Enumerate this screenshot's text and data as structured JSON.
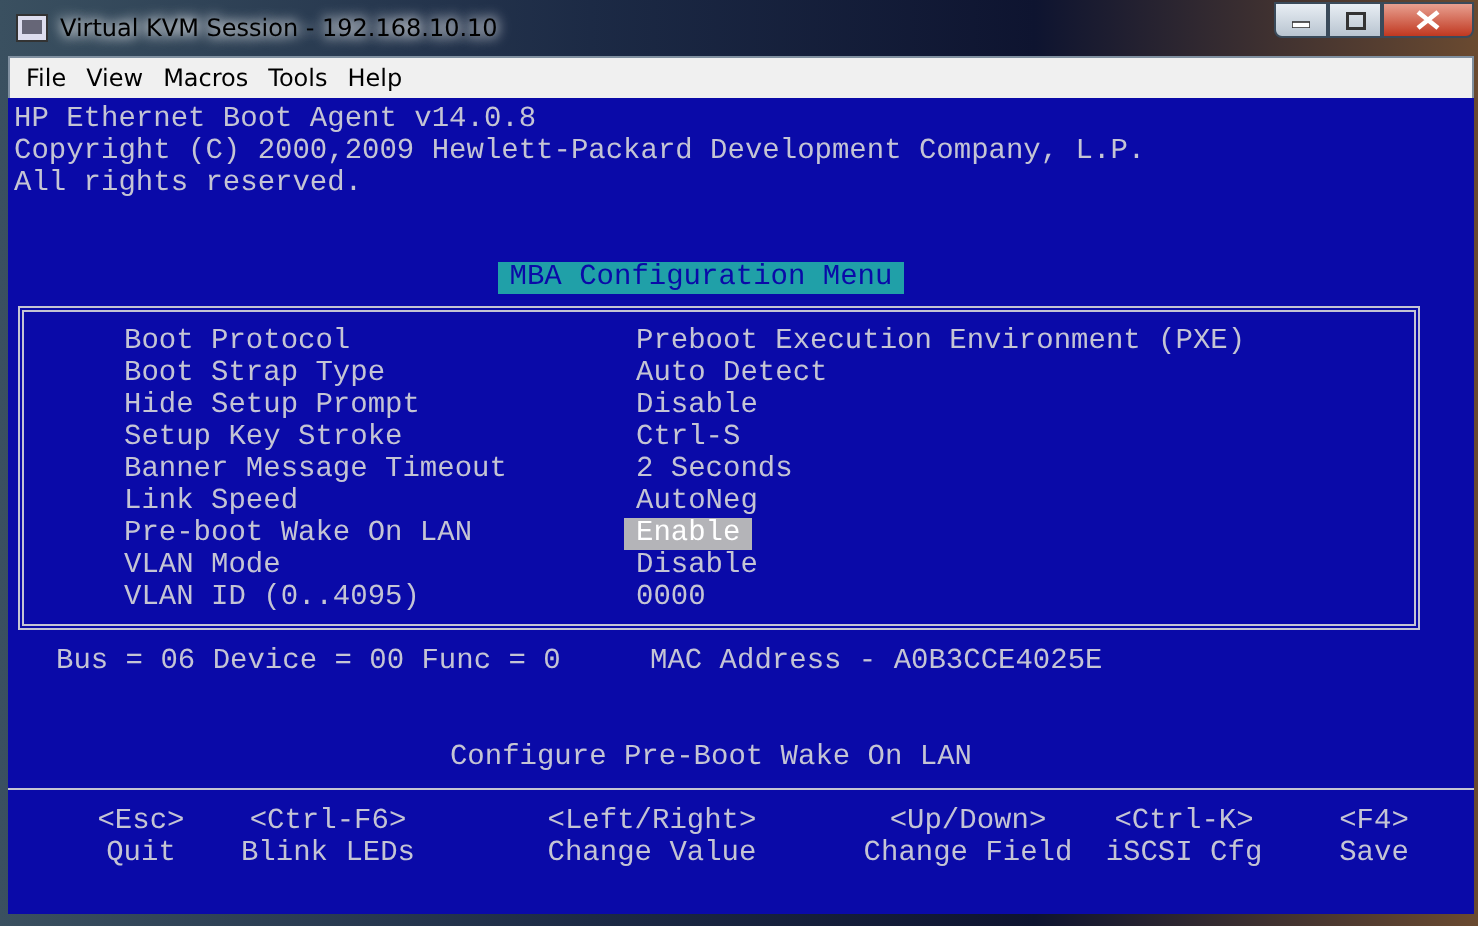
{
  "window": {
    "title": "Virtual KVM Session - 192.168.10.10"
  },
  "menu": [
    "File",
    "View",
    "Macros",
    "Tools",
    "Help"
  ],
  "header_lines": [
    "HP Ethernet Boot Agent v14.0.8",
    "Copyright (C) 2000,2009 Hewlett-Packard Development Company, L.P.",
    "All rights reserved."
  ],
  "menu_title": "MBA Configuration Menu",
  "settings": [
    {
      "label": "Boot Protocol",
      "value": "Preboot Execution Environment (PXE)",
      "selected": false
    },
    {
      "label": "Boot Strap Type",
      "value": "Auto Detect",
      "selected": false
    },
    {
      "label": "Hide Setup Prompt",
      "value": "Disable",
      "selected": false
    },
    {
      "label": "Setup Key Stroke",
      "value": "Ctrl-S",
      "selected": false
    },
    {
      "label": "Banner Message Timeout",
      "value": "2 Seconds",
      "selected": false
    },
    {
      "label": "Link Speed",
      "value": "AutoNeg",
      "selected": false
    },
    {
      "label": "Pre-boot Wake On LAN",
      "value": "Enable",
      "selected": true
    },
    {
      "label": "VLAN Mode",
      "value": "Disable",
      "selected": false
    },
    {
      "label": "VLAN ID (0..4095)",
      "value": "0000",
      "selected": false
    }
  ],
  "device_info": "Bus = 06 Device = 00 Func = 0",
  "mac_address": "MAC Address - A0B3CCE4025E",
  "help_text": "Configure Pre-Boot Wake On LAN",
  "keys": [
    {
      "key": "<Esc>",
      "action": "Quit"
    },
    {
      "key": "<Ctrl-F6>",
      "action": "Blink LEDs"
    },
    {
      "key": "<Left/Right>",
      "action": "Change Value"
    },
    {
      "key": "<Up/Down>",
      "action": "Change Field"
    },
    {
      "key": "<Ctrl-K>",
      "action": "iSCSI Cfg"
    },
    {
      "key": "<F4>",
      "action": "Save"
    }
  ]
}
